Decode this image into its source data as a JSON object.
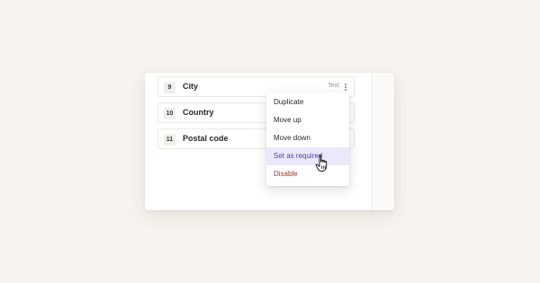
{
  "fields": [
    {
      "number": "9",
      "label": "City",
      "type": "Text"
    },
    {
      "number": "10",
      "label": "Country",
      "type": ""
    },
    {
      "number": "11",
      "label": "Postal code",
      "type": ""
    }
  ],
  "context_menu": {
    "items": [
      {
        "label": "Duplicate"
      },
      {
        "label": "Move up"
      },
      {
        "label": "Move down"
      },
      {
        "label": "Set as required",
        "state": "hovered"
      },
      {
        "label": "Disable",
        "style": "danger"
      }
    ]
  },
  "colors": {
    "background": "#f7f4f0",
    "hover_bg": "#ebe8fb",
    "hover_text": "#4a3fb0",
    "danger_text": "#a8341f"
  },
  "icons": {
    "more": "kebab-menu-icon",
    "cursor": "hand-pointer-icon"
  }
}
